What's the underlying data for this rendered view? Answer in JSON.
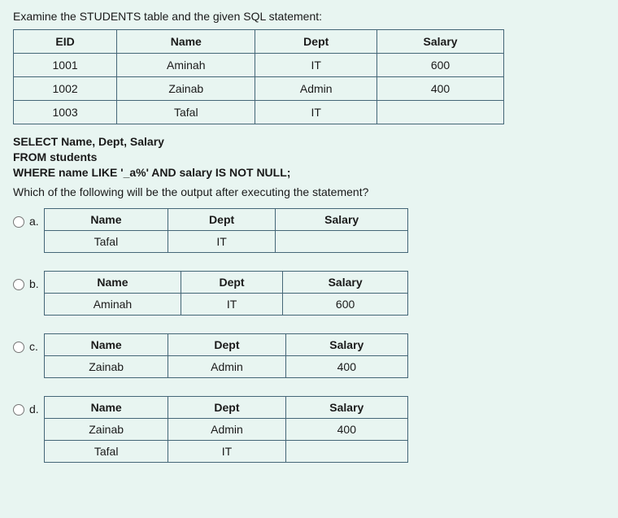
{
  "intro": "Examine the STUDENTS table and the given SQL statement:",
  "main_table": {
    "headers": [
      "EID",
      "Name",
      "Dept",
      "Salary"
    ],
    "rows": [
      [
        "1001",
        "Aminah",
        "IT",
        "600"
      ],
      [
        "1002",
        "Zainab",
        "Admin",
        "400"
      ],
      [
        "1003",
        "Tafal",
        "IT",
        ""
      ]
    ]
  },
  "sql": {
    "line1": "SELECT Name, Dept, Salary",
    "line2": "FROM students",
    "line3": "WHERE name LIKE '_a%' AND salary IS NOT NULL;"
  },
  "question": "Which of the following will be the output after executing the statement?",
  "options": {
    "a": {
      "label": "a.",
      "headers": [
        "Name",
        "Dept",
        "Salary"
      ],
      "rows": [
        [
          "Tafal",
          "IT",
          ""
        ]
      ]
    },
    "b": {
      "label": "b.",
      "headers": [
        "Name",
        "Dept",
        "Salary"
      ],
      "rows": [
        [
          "Aminah",
          "IT",
          "600"
        ]
      ]
    },
    "c": {
      "label": "c.",
      "headers": [
        "Name",
        "Dept",
        "Salary"
      ],
      "rows": [
        [
          "Zainab",
          "Admin",
          "400"
        ]
      ]
    },
    "d": {
      "label": "d.",
      "headers": [
        "Name",
        "Dept",
        "Salary"
      ],
      "rows": [
        [
          "Zainab",
          "Admin",
          "400"
        ],
        [
          "Tafal",
          "IT",
          ""
        ]
      ]
    }
  }
}
